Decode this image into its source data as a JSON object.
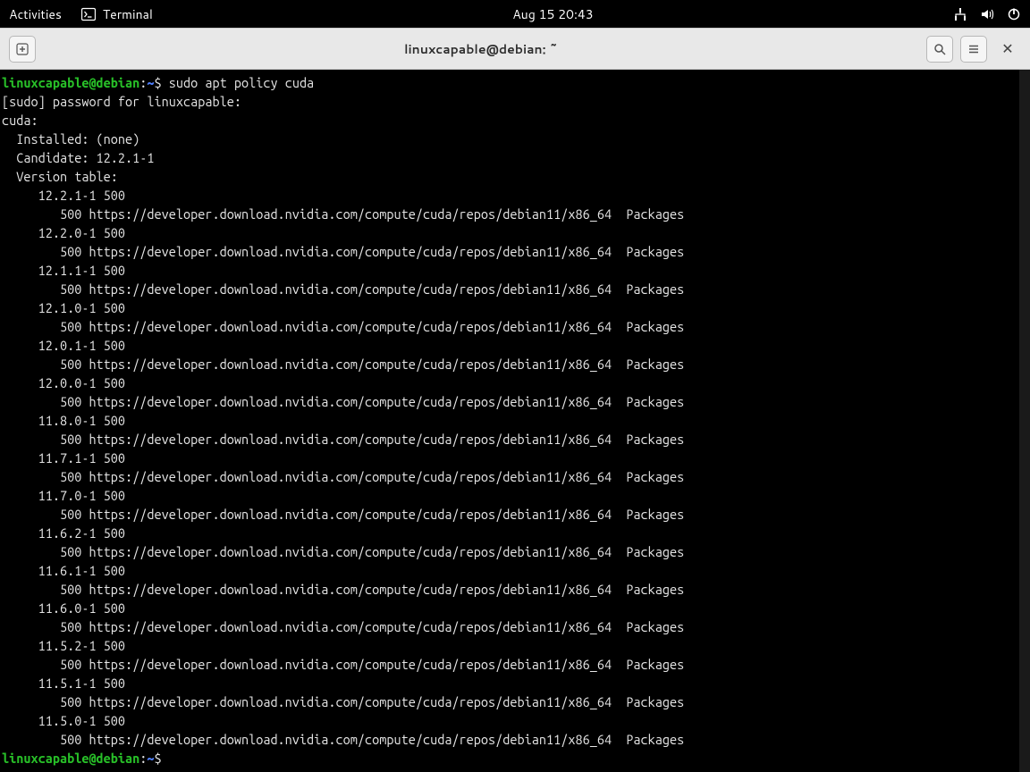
{
  "topbar": {
    "activities": "Activities",
    "terminal": "Terminal",
    "datetime": "Aug 15  20:43"
  },
  "window": {
    "title": "linuxcapable@debian: ~"
  },
  "prompt": {
    "user_host": "linuxcapable@debian",
    "colon": ":",
    "path": "~",
    "dollar": "$ ",
    "final_dollar": "$ "
  },
  "command": "sudo apt policy cuda",
  "sudo_line": "[sudo] password for linuxcapable: ",
  "pkg_header": "cuda:",
  "installed": "  Installed: (none)",
  "candidate": "  Candidate: 12.2.1-1",
  "vtable_header": "  Version table:",
  "repo_line": "        500 https://developer.download.nvidia.com/compute/cuda/repos/debian11/x86_64  Packages",
  "versions": [
    "     12.2.1-1 500",
    "     12.2.0-1 500",
    "     12.1.1-1 500",
    "     12.1.0-1 500",
    "     12.0.1-1 500",
    "     12.0.0-1 500",
    "     11.8.0-1 500",
    "     11.7.1-1 500",
    "     11.7.0-1 500",
    "     11.6.2-1 500",
    "     11.6.1-1 500",
    "     11.6.0-1 500",
    "     11.5.2-1 500",
    "     11.5.1-1 500",
    "     11.5.0-1 500"
  ]
}
